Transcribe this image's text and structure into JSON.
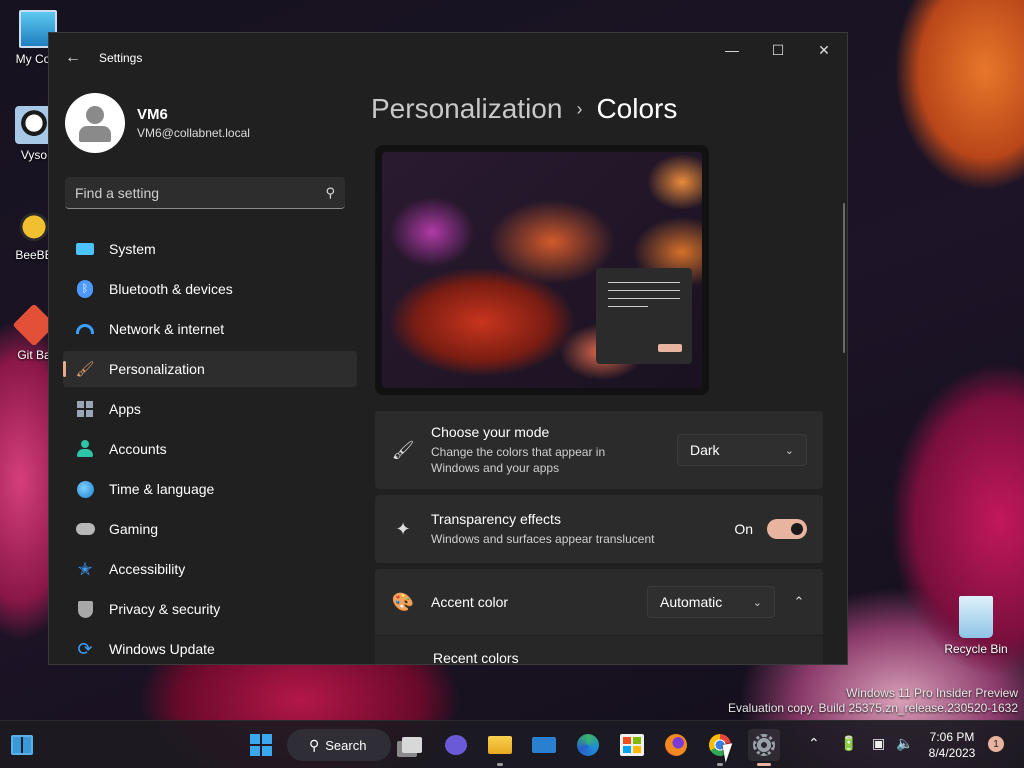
{
  "desktop": {
    "icons": [
      {
        "label": "My Com",
        "icon": "computer-icon"
      },
      {
        "label": "Vyso",
        "icon": "app-shortcut-icon"
      },
      {
        "label": "BeeBE",
        "icon": "bee-icon"
      },
      {
        "label": "Git Ba",
        "icon": "git-icon"
      }
    ],
    "recycle_bin": "Recycle Bin",
    "watermark_line1": "Windows 11 Pro Insider Preview",
    "watermark_line2": "Evaluation copy. Build 25375.zn_release.230520-1632"
  },
  "window": {
    "title": "Settings",
    "back_icon": "back-arrow-icon",
    "controls": {
      "minimize": "—",
      "maximize": "☐",
      "close": "✕"
    }
  },
  "profile": {
    "name": "VM6",
    "email": "VM6@collabnet.local"
  },
  "search": {
    "placeholder": "Find a setting"
  },
  "nav": [
    {
      "label": "System",
      "icon": "monitor-icon",
      "color": "#4cc2ff",
      "active": false
    },
    {
      "label": "Bluetooth & devices",
      "icon": "bluetooth-icon",
      "color": "#4c9aff",
      "active": false
    },
    {
      "label": "Network & internet",
      "icon": "wifi-icon",
      "color": "#3aa0ff",
      "active": false
    },
    {
      "label": "Personalization",
      "icon": "brush-icon",
      "color": "#e0a070",
      "active": true
    },
    {
      "label": "Apps",
      "icon": "apps-icon",
      "color": "#9aa5b8",
      "active": false
    },
    {
      "label": "Accounts",
      "icon": "person-icon",
      "color": "#2ec4a6",
      "active": false
    },
    {
      "label": "Time & language",
      "icon": "globe-clock-icon",
      "color": "#4cb0ff",
      "active": false
    },
    {
      "label": "Gaming",
      "icon": "gamepad-icon",
      "color": "#b8b8b8",
      "active": false
    },
    {
      "label": "Accessibility",
      "icon": "accessibility-icon",
      "color": "#3aa0ff",
      "active": false
    },
    {
      "label": "Privacy & security",
      "icon": "shield-icon",
      "color": "#a8a8a8",
      "active": false
    },
    {
      "label": "Windows Update",
      "icon": "update-icon",
      "color": "#3aa0ff",
      "active": false
    }
  ],
  "breadcrumb": {
    "parent": "Personalization",
    "separator": "›",
    "current": "Colors"
  },
  "mode_card": {
    "title": "Choose your mode",
    "desc_line1": "Change the colors that appear in",
    "desc_line2": "Windows and your apps",
    "value": "Dark",
    "icon": "paint-brush-icon"
  },
  "transparency_card": {
    "title": "Transparency effects",
    "desc": "Windows and surfaces appear translucent",
    "state": "On",
    "icon": "sparkle-icon"
  },
  "accent_card": {
    "title": "Accent color",
    "value": "Automatic",
    "icon": "palette-icon"
  },
  "recent_colors": {
    "label": "Recent colors"
  },
  "taskbar": {
    "search_label": "Search",
    "clock_time": "7:06 PM",
    "clock_date": "8/4/2023",
    "notification_count": "1",
    "accent": "#e8b4a0"
  }
}
